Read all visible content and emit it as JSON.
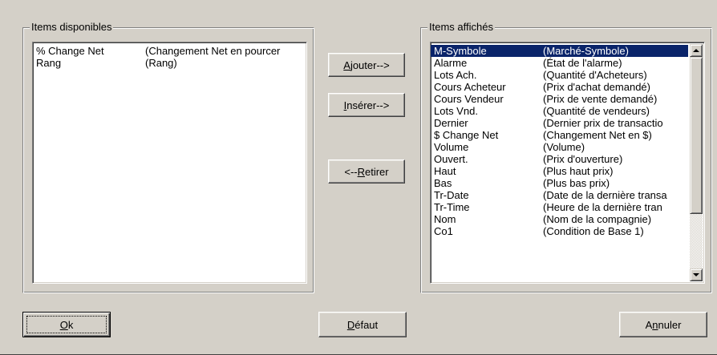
{
  "available": {
    "legend": "Items disponibles",
    "items": [
      {
        "code": "% Change Net",
        "desc": "(Changement Net en pourcer"
      },
      {
        "code": "Rang",
        "desc": "(Rang)"
      }
    ]
  },
  "displayed": {
    "legend": "Items affichés",
    "selected_index": 0,
    "items": [
      {
        "code": "M-Symbole",
        "desc": "(Marché-Symbole)"
      },
      {
        "code": "Alarme",
        "desc": "(État de l'alarme)"
      },
      {
        "code": "Lots Ach.",
        "desc": "(Quantité d'Acheteurs)"
      },
      {
        "code": "Cours Acheteur",
        "desc": "(Prix d'achat demandé)"
      },
      {
        "code": "Cours Vendeur",
        "desc": "(Prix de vente demandé)"
      },
      {
        "code": "Lots Vnd.",
        "desc": "(Quantité de vendeurs)"
      },
      {
        "code": "Dernier",
        "desc": "(Dernier prix de transactio"
      },
      {
        "code": "$ Change Net",
        "desc": "(Changement Net en $)"
      },
      {
        "code": "Volume",
        "desc": "(Volume)"
      },
      {
        "code": "Ouvert.",
        "desc": "(Prix d'ouverture)"
      },
      {
        "code": "Haut",
        "desc": "(Plus haut prix)"
      },
      {
        "code": "Bas",
        "desc": "(Plus bas prix)"
      },
      {
        "code": "Tr-Date",
        "desc": "(Date de la dernière transa"
      },
      {
        "code": "Tr-Time",
        "desc": "(Heure de la dernière tran"
      },
      {
        "code": "Nom",
        "desc": "(Nom de la compagnie)"
      },
      {
        "code": "Co1",
        "desc": "(Condition de Base 1)"
      }
    ]
  },
  "buttons": {
    "ajouter": {
      "acc": "A",
      "rest": "jouter-->"
    },
    "inserer": {
      "acc": "I",
      "rest": "nsérer-->"
    },
    "retirer": {
      "pre": "<--",
      "acc": "R",
      "rest": "etirer"
    },
    "ok": {
      "acc": "O",
      "rest": "k"
    },
    "defaut": {
      "acc": "D",
      "rest": "éfaut"
    },
    "annuler": {
      "pre": "A",
      "acc": "n",
      "rest": "nuler"
    }
  },
  "icons": {
    "scroll_up": "scroll-up-arrow-icon",
    "scroll_down": "scroll-down-arrow-icon"
  },
  "colors": {
    "selection": "#0a246a",
    "face": "#d4d0c8"
  }
}
